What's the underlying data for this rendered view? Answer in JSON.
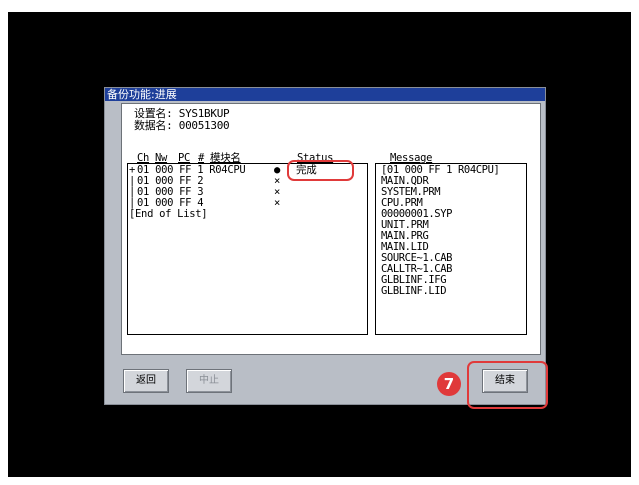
{
  "window": {
    "title": "备份功能:进展"
  },
  "info": {
    "setting_label": "设置名:",
    "setting_value": "SYS1BKUP",
    "data_label": "数据名:",
    "data_value": "00051300"
  },
  "headers": {
    "ch": "Ch",
    "nw": "Nw",
    "pc": "PC",
    "hash": "#",
    "module": "模块名",
    "status": "Status",
    "message": "Message"
  },
  "list": {
    "rows": [
      {
        "tree": "+",
        "text": "01 000 FF 1 R04CPU",
        "status": "●",
        "status_text": "完成"
      },
      {
        "tree": "|",
        "text": "01 000 FF 2",
        "status": "×",
        "status_text": ""
      },
      {
        "tree": "|",
        "text": "01 000 FF 3",
        "status": "×",
        "status_text": ""
      },
      {
        "tree": "|",
        "text": "01 000 FF 4",
        "status": "×",
        "status_text": ""
      },
      {
        "tree": "",
        "text": "[End of List]",
        "status": "",
        "status_text": ""
      }
    ]
  },
  "messages": [
    "[01 000 FF 1 R04CPU]",
    "MAIN.QDR",
    "SYSTEM.PRM",
    "CPU.PRM",
    "00000001.SYP",
    "UNIT.PRM",
    "MAIN.PRG",
    "MAIN.LID",
    "SOURCE~1.CAB",
    "CALLTR~1.CAB",
    "GLBLINF.IFG",
    "GLBLINF.LID"
  ],
  "buttons": {
    "return_label": "返回",
    "stop_label": "中止",
    "end_label": "结束"
  },
  "annotation": {
    "step_number": "7",
    "color": "#e0393a"
  },
  "colors": {
    "titlebar": "#1e3f9a",
    "dialog": "#b9bec6",
    "screen": "#000000"
  }
}
